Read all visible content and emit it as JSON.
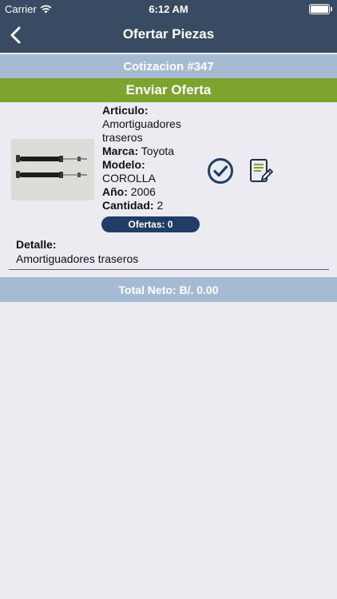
{
  "status_bar": {
    "carrier": "Carrier",
    "time": "6:12 AM"
  },
  "nav": {
    "title": "Ofertar Piezas"
  },
  "quote": {
    "label": "Cotizacion #347"
  },
  "send_offer": {
    "label": "Enviar Oferta"
  },
  "product": {
    "article_label": "Articulo:",
    "article_value": "Amortiguadores traseros",
    "brand_label": "Marca:",
    "brand_value": "Toyota",
    "model_label": "Modelo:",
    "model_value": "COROLLA",
    "year_label": "Año:",
    "year_value": "2006",
    "qty_label": "Cantidad:",
    "qty_value": "2",
    "offers": "Ofertas: 0"
  },
  "detail": {
    "label": "Detalle:",
    "value": "Amortiguadores traseros"
  },
  "total": {
    "label": "Total Neto: B/. 0.00"
  },
  "colors": {
    "nav": "#394b63",
    "bar": "#a5bbd3",
    "accent_green": "#7ea42f",
    "pill": "#1f3d66"
  }
}
